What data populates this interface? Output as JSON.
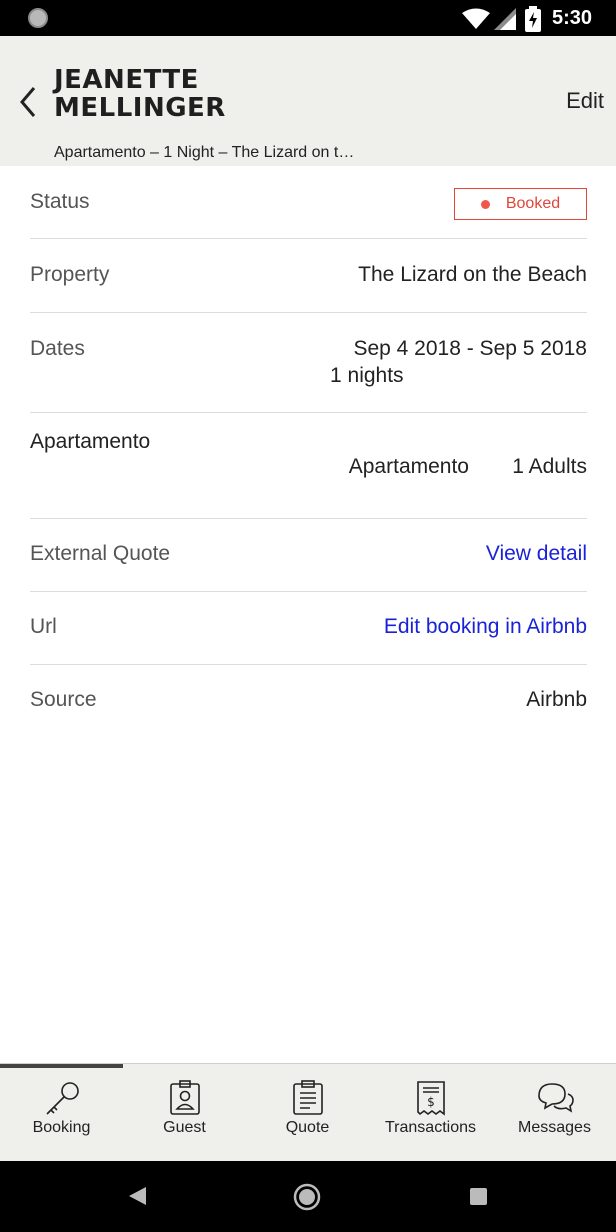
{
  "status_bar": {
    "time": "5:30"
  },
  "header": {
    "title_line1": "JEANETTE",
    "title_line2": "MELLINGER",
    "edit_label": "Edit",
    "subtitle": "Apartamento – 1 Night – The Lizard on t…"
  },
  "details": {
    "status": {
      "label": "Status",
      "badge": "Booked",
      "badge_color": "#e0463a"
    },
    "property": {
      "label": "Property",
      "value": "The Lizard on the Beach"
    },
    "dates": {
      "label": "Dates",
      "range": "Sep 4 2018 - Sep 5 2018",
      "nights": "1 nights"
    },
    "room": {
      "label": "Apartamento",
      "unit": "Apartamento",
      "guests": "1 Adults"
    },
    "external_quote": {
      "label": "External Quote",
      "link": "View detail"
    },
    "url": {
      "label": "Url",
      "link": "Edit booking in Airbnb"
    },
    "source": {
      "label": "Source",
      "value": "Airbnb"
    }
  },
  "link_color": "#1a22d8",
  "bottom_nav": [
    {
      "label": "Booking",
      "icon": "key-icon",
      "active": true
    },
    {
      "label": "Guest",
      "icon": "guest-badge-icon",
      "active": false
    },
    {
      "label": "Quote",
      "icon": "clipboard-icon",
      "active": false
    },
    {
      "label": "Transactions",
      "icon": "receipt-icon",
      "active": false
    },
    {
      "label": "Messages",
      "icon": "chat-bubbles-icon",
      "active": false
    }
  ]
}
